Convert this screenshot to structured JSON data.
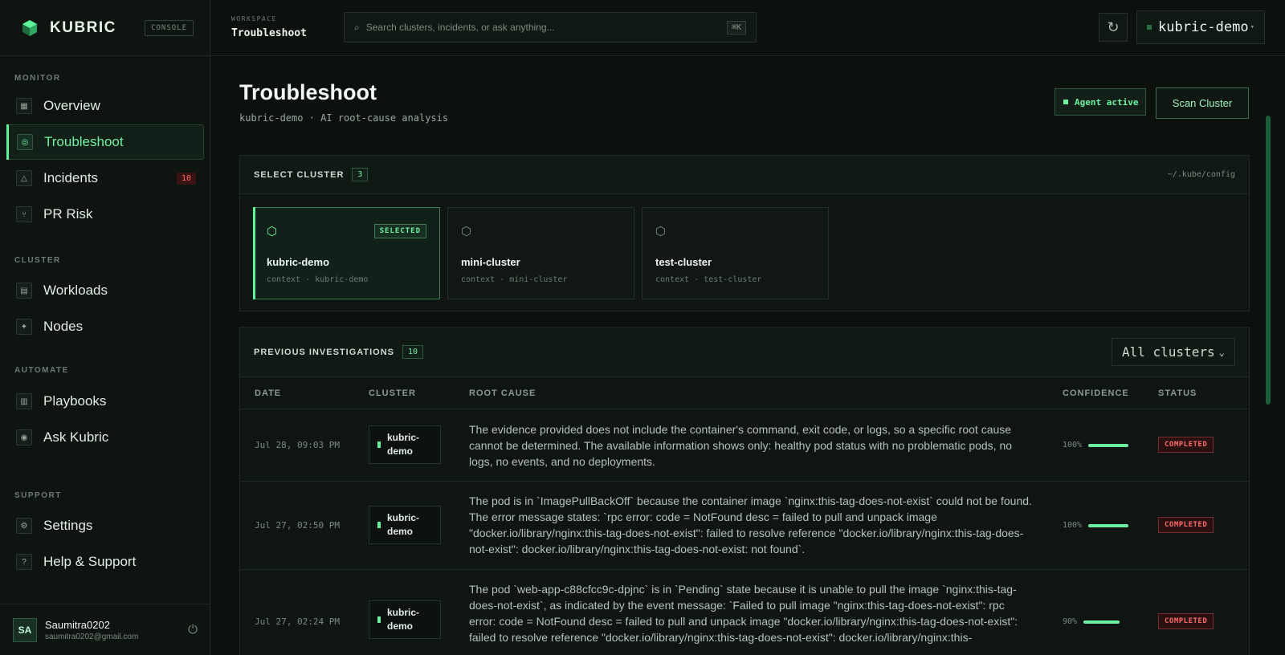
{
  "brand": {
    "name": "KUBRIC",
    "badge": "CONSOLE"
  },
  "sidebar": {
    "sections": [
      {
        "label": "MONITOR",
        "items": [
          {
            "label": "Overview",
            "icon": "grid-icon"
          },
          {
            "label": "Troubleshoot",
            "icon": "target-icon",
            "active": true
          },
          {
            "label": "Incidents",
            "icon": "alert-icon",
            "badge": "10"
          },
          {
            "label": "PR Risk",
            "icon": "branch-icon"
          }
        ]
      },
      {
        "label": "CLUSTER",
        "items": [
          {
            "label": "Workloads",
            "icon": "layers-icon"
          },
          {
            "label": "Nodes",
            "icon": "node-icon"
          }
        ]
      },
      {
        "label": "AUTOMATE",
        "items": [
          {
            "label": "Playbooks",
            "icon": "book-icon"
          },
          {
            "label": "Ask Kubric",
            "icon": "chat-icon"
          }
        ]
      },
      {
        "label": "SUPPORT",
        "items": [
          {
            "label": "Settings",
            "icon": "gear-icon"
          },
          {
            "label": "Help & Support",
            "icon": "help-icon"
          }
        ]
      }
    ],
    "user": {
      "initials": "SA",
      "name": "Saumitra0202",
      "email": "saumitra0202@gmail.com"
    }
  },
  "topbar": {
    "workspace_label": "WORKSPACE",
    "workspace_name": "Troubleshoot",
    "search_placeholder": "Search clusters, incidents, or ask anything...",
    "search_shortcut": "⌘K",
    "context": "kubric-demo"
  },
  "page": {
    "title": "Troubleshoot",
    "subtitle": "kubric-demo · AI root-cause analysis",
    "agent_status": "Agent active",
    "scan_button": "Scan Cluster"
  },
  "clusters": {
    "title": "SELECT CLUSTER",
    "count": "3",
    "config_path": "~/.kube/config",
    "selected_label": "SELECTED",
    "items": [
      {
        "name": "kubric-demo",
        "context": "context · kubric-demo",
        "selected": true
      },
      {
        "name": "mini-cluster",
        "context": "context · mini-cluster"
      },
      {
        "name": "test-cluster",
        "context": "context · test-cluster"
      }
    ]
  },
  "investigations": {
    "title": "PREVIOUS INVESTIGATIONS",
    "count": "10",
    "filter": "All clusters",
    "columns": [
      "DATE",
      "CLUSTER",
      "ROOT CAUSE",
      "CONFIDENCE",
      "STATUS"
    ],
    "rows": [
      {
        "date": "Jul 28, 09:03 PM",
        "cluster_line1": "kubric-",
        "cluster_line2": "demo",
        "cause": "The evidence provided does not include the container's command, exit code, or logs, so a specific root cause cannot be determined. The available information shows only: healthy pod status with no problematic pods, no logs, no events, and no deployments.",
        "confidence": 100,
        "confidence_label": "100%",
        "status": "COMPLETED"
      },
      {
        "date": "Jul 27, 02:50 PM",
        "cluster_line1": "kubric-",
        "cluster_line2": "demo",
        "cause": "The pod is in `ImagePullBackOff` because the container image `nginx:this-tag-does-not-exist` could not be found. The error message states: `rpc error: code = NotFound desc = failed to pull and unpack image \"docker.io/library/nginx:this-tag-does-not-exist\": failed to resolve reference \"docker.io/library/nginx:this-tag-does-not-exist\": docker.io/library/nginx:this-tag-does-not-exist: not found`.",
        "confidence": 100,
        "confidence_label": "100%",
        "status": "COMPLETED"
      },
      {
        "date": "Jul 27, 02:24 PM",
        "cluster_line1": "kubric-",
        "cluster_line2": "demo",
        "cause": "The pod `web-app-c88cfcc9c-dpjnc` is in `Pending` state because it is unable to pull the image `nginx:this-tag-does-not-exist`, as indicated by the event message: `Failed to pull image \"nginx:this-tag-does-not-exist\": rpc error: code = NotFound desc = failed to pull and unpack image \"docker.io/library/nginx:this-tag-does-not-exist\": failed to resolve reference \"docker.io/library/nginx:this-tag-does-not-exist\": docker.io/library/nginx:this-",
        "confidence": 90,
        "confidence_label": "90%",
        "status": "COMPLETED"
      }
    ]
  }
}
